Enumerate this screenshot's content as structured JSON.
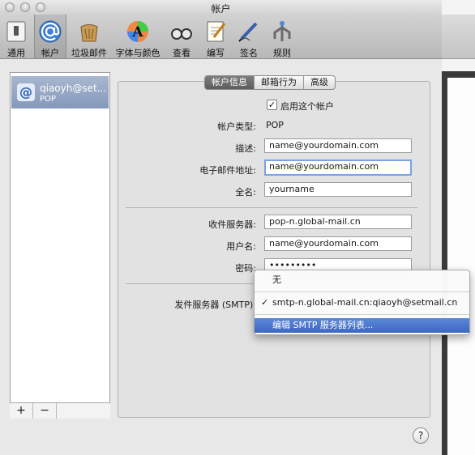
{
  "window": {
    "title": "帐户"
  },
  "toolbar": {
    "items": [
      {
        "label": "通用",
        "icon": "switch-icon"
      },
      {
        "label": "帐户",
        "icon": "at-sign-icon"
      },
      {
        "label": "垃圾邮件",
        "icon": "trash-bag-icon"
      },
      {
        "label": "字体与颜色",
        "icon": "font-colors-icon"
      },
      {
        "label": "查看",
        "icon": "glasses-icon"
      },
      {
        "label": "编写",
        "icon": "compose-icon"
      },
      {
        "label": "签名",
        "icon": "pen-icon"
      },
      {
        "label": "规则",
        "icon": "rules-icon"
      }
    ]
  },
  "sidebar": {
    "account_name": "qiaoyh@set...",
    "account_type": "POP",
    "add_label": "+",
    "remove_label": "−"
  },
  "tabs": [
    "帐户信息",
    "邮箱行为",
    "高级"
  ],
  "form": {
    "enable_label": "启用这个帐户",
    "account_type_label": "帐户类型:",
    "account_type_value": "POP",
    "description_label": "描述:",
    "description_value": "name@yourdomain.com",
    "email_label": "电子邮件地址:",
    "email_value": "name@yourdomain.com",
    "fullname_label": "全名:",
    "fullname_value": "yourname",
    "incoming_label": "收件服务器:",
    "incoming_value": "pop-n.global-mail.cn",
    "username_label": "用户名:",
    "username_value": "name@yourdomain.com",
    "password_label": "密码:",
    "password_value": "•••••••••",
    "smtp_label": "发件服务器 (SMTP):"
  },
  "smtp_menu": {
    "none": "无",
    "checkmark": "✓",
    "selected": "smtp-n.global-mail.cn:qiaoyh@setmail.cn",
    "edit": "编辑 SMTP 服务器列表..."
  },
  "help": {
    "label": "?"
  },
  "colors": {
    "accent": "#3d67c2",
    "selection": "#8498bb",
    "focus": "#7aa3e0"
  }
}
